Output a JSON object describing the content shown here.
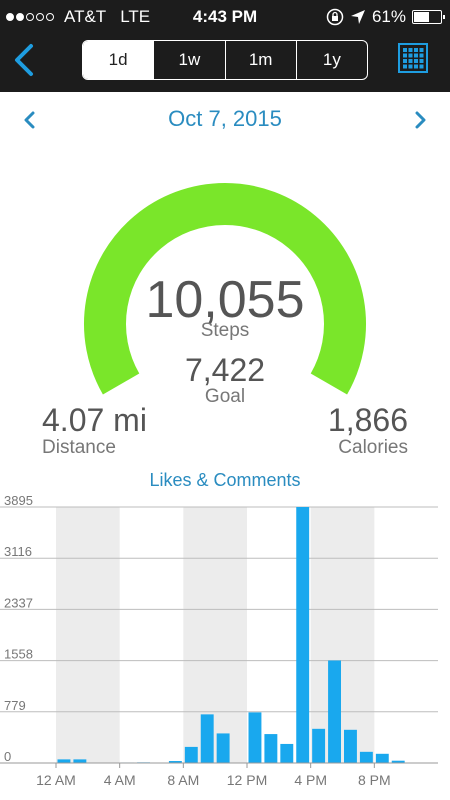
{
  "status": {
    "carrier": "AT&T",
    "network": "LTE",
    "time": "4:43 PM",
    "battery": "61%",
    "battery_level": 0.61,
    "signal_bars": 2
  },
  "nav": {
    "ranges": [
      "1d",
      "1w",
      "1m",
      "1y"
    ],
    "selected_range": "1d"
  },
  "date": "Oct 7, 2015",
  "summary": {
    "steps_value": "10,055",
    "steps_label": "Steps",
    "goal_value": "7,422",
    "goal_label": "Goal",
    "distance_value": "4.07 mi",
    "distance_label": "Distance",
    "calories_value": "1,866",
    "calories_label": "Calories"
  },
  "colors": {
    "gauge": "#7ae62a",
    "accent": "#2a8cc0",
    "bar": "#19a8ee",
    "topbar": "#1c1c1c"
  },
  "chart_data": {
    "type": "bar",
    "title": "Likes & Comments",
    "ylim": [
      0,
      3895
    ],
    "yticks": [
      0,
      779,
      1558,
      2337,
      3116,
      3895
    ],
    "xtick_labels": [
      "12 AM",
      "4 AM",
      "8 AM",
      "12 PM",
      "4 PM",
      "8 PM"
    ],
    "xtick_hours": [
      0,
      4,
      8,
      12,
      16,
      20
    ],
    "shaded_hour_bands": [
      [
        0,
        4
      ],
      [
        8,
        12
      ],
      [
        16,
        20
      ]
    ],
    "series": [
      {
        "hours": [
          0,
          1,
          2,
          3,
          4,
          5,
          6,
          7,
          8,
          9,
          10,
          11,
          12,
          13,
          14,
          15,
          16,
          17,
          18,
          19,
          20,
          21,
          22,
          23
        ],
        "values": [
          55,
          55,
          0,
          0,
          8,
          10,
          0,
          30,
          245,
          740,
          450,
          0,
          770,
          440,
          290,
          3895,
          520,
          1560,
          505,
          170,
          140,
          35,
          0,
          0
        ]
      }
    ]
  }
}
